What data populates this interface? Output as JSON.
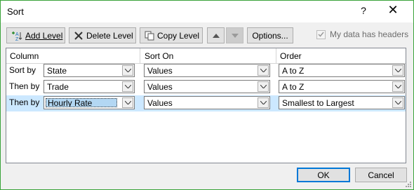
{
  "dialog": {
    "title": "Sort",
    "help_label": "?",
    "close_label": "✕"
  },
  "toolbar": {
    "add_level": "Add Level",
    "delete_level": "Delete Level",
    "copy_level": "Copy Level",
    "options": "Options...",
    "my_data_has_headers": "My data has headers",
    "my_data_has_headers_checked": true
  },
  "columns": {
    "column": "Column",
    "sort_on": "Sort On",
    "order": "Order"
  },
  "levels": [
    {
      "label": "Sort by",
      "column": "State",
      "sort_on": "Values",
      "order": "A to Z"
    },
    {
      "label": "Then by",
      "column": "Trade",
      "sort_on": "Values",
      "order": "A to Z"
    },
    {
      "label": "Then by",
      "column": "Hourly Rate",
      "sort_on": "Values",
      "order": "Smallest to Largest",
      "selected": true
    }
  ],
  "footer": {
    "ok": "OK",
    "cancel": "Cancel"
  },
  "colors": {
    "window_border": "#3aa33a",
    "selection": "#cce8ff",
    "default_button_border": "#0078d7"
  }
}
